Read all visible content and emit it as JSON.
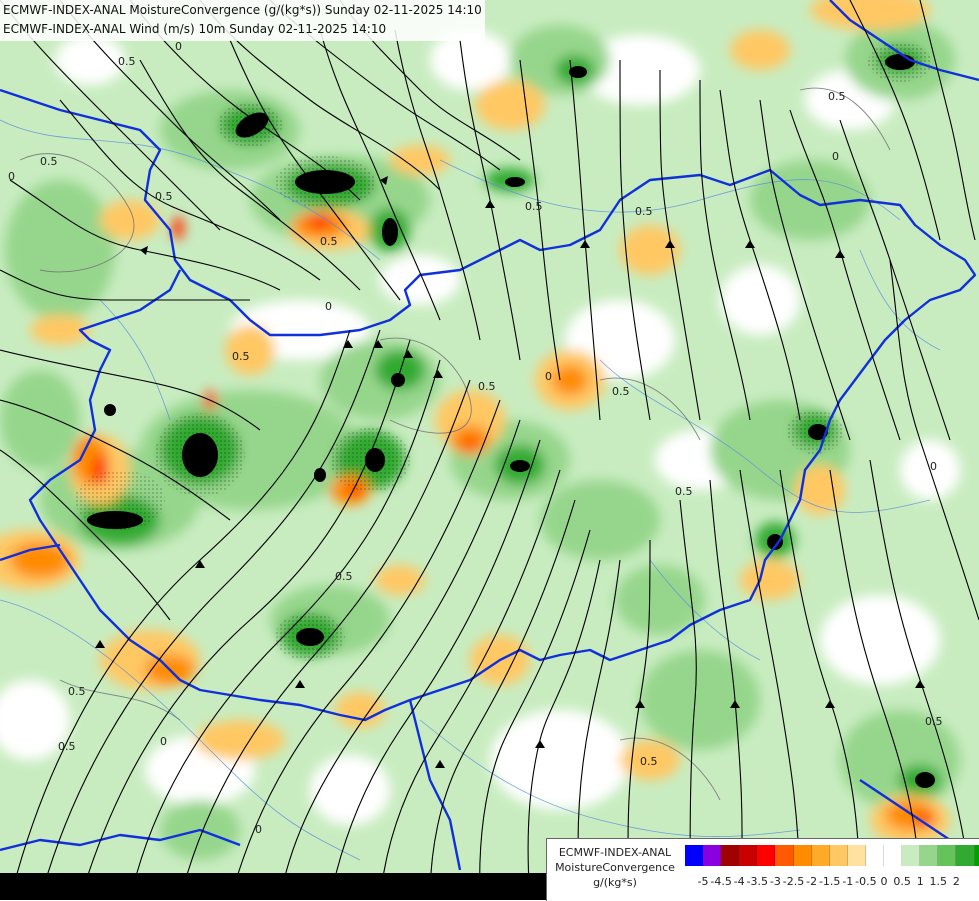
{
  "header": {
    "line1": "ECMWF-INDEX-ANAL MoistureConvergence (g/(kg*s)) Sunday 02-11-2025 14:10",
    "line2": "ECMWF-INDEX-ANAL Wind (m/s) 10m Sunday 02-11-2025 14:10"
  },
  "legend": {
    "title_line1": "ECMWF-INDEX-ANAL",
    "title_line2": "MoistureConvergence",
    "title_line3": "g/(kg*s)",
    "colors": [
      "#0000ff",
      "#8a00e0",
      "#a00000",
      "#c80000",
      "#ff0000",
      "#ff5a00",
      "#ff8c00",
      "#ffaa28",
      "#ffc864",
      "#ffe1a0",
      "#ffffff",
      "#ffffff",
      "#c8ecc0",
      "#96d68c",
      "#64c35a",
      "#32aa32",
      "#00a000"
    ],
    "ticks": [
      "-5",
      "-4.5",
      "-4",
      "-3.5",
      "-3",
      "-2.5",
      "-2",
      "-1.5",
      "-1",
      "-0.5",
      "0",
      "0.5",
      "1",
      "1.5",
      "2"
    ]
  },
  "contour_labels": [
    "0.5",
    "0",
    "0.5",
    "0",
    "0.5",
    "0.5",
    "0",
    "0.5",
    "0.5",
    "0",
    "0.5",
    "0.5",
    "0.5",
    "0",
    "0.5",
    "0.5",
    "0",
    "0.5",
    "0.5",
    "0.5",
    "0",
    "0.5",
    "0.5",
    "0"
  ],
  "icons": [
    "wind-streamline-arrow",
    "border-line",
    "river-line"
  ]
}
